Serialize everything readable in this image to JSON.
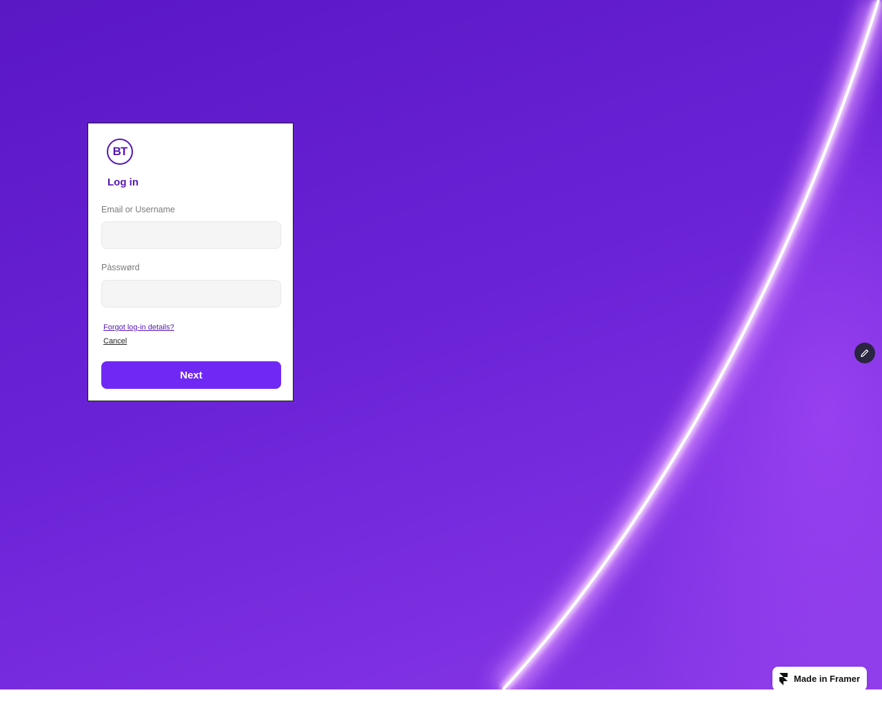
{
  "brand": {
    "logo_text": "BT",
    "accent_color": "#5514b4",
    "button_color": "#7029f5"
  },
  "login": {
    "title": "Log in",
    "email_label": "Email or Username",
    "email_value": "",
    "password_label": "Pàsswørd",
    "password_value": "",
    "forgot_link": "Forgot log-in details?",
    "cancel_link": "Cancel",
    "next_button": "Next"
  },
  "edit_button": {
    "icon": "pencil-icon"
  },
  "framer_badge": {
    "icon": "framer-logo-icon",
    "label": "Made in Framer"
  }
}
